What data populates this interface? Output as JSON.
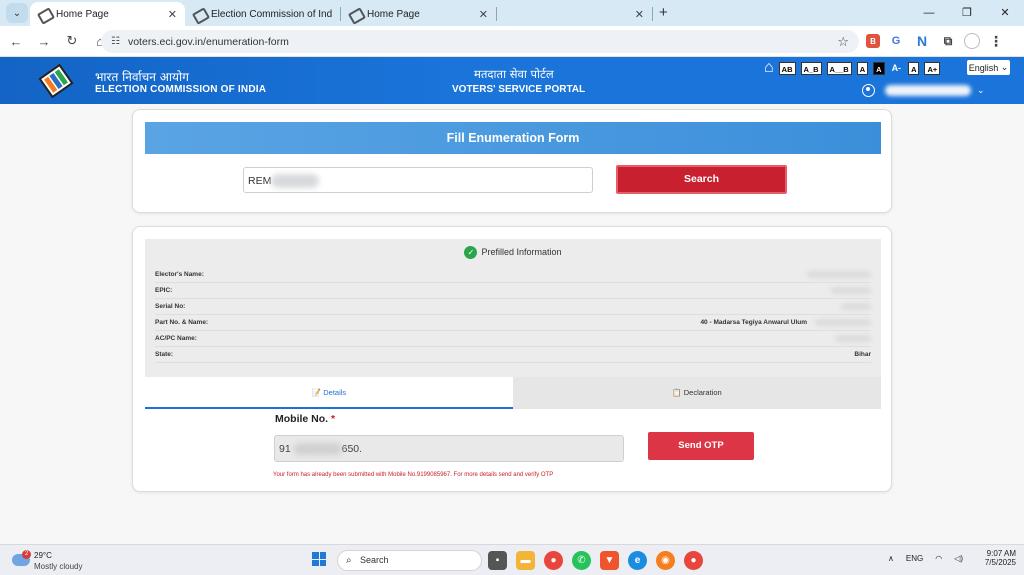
{
  "browser": {
    "tabs": [
      {
        "title": "Home Page",
        "active": true
      },
      {
        "title": "Election Commission of India",
        "active": false
      },
      {
        "title": "Home Page",
        "active": false
      },
      {
        "title": "",
        "active": false,
        "blurred": true
      }
    ],
    "url": "voters.eci.gov.in/enumeration-form"
  },
  "header": {
    "org_hindi": "भारत निर्वाचन आयोग",
    "org_english": "ELECTION COMMISSION OF INDIA",
    "portal_hindi": "मतदाता सेवा पोर्टल",
    "portal_english": "VOTERS' SERVICE PORTAL",
    "accessibility": [
      "AB",
      "A_B",
      "A__B",
      "A",
      "A",
      "A-",
      "A",
      "A+"
    ],
    "language": "English",
    "colors": {
      "header_blue": "#1a74da"
    }
  },
  "search_card": {
    "title": "Fill Enumeration Form",
    "input_value": "REM",
    "search_label": "Search"
  },
  "prefilled": {
    "title": "Prefilled Information",
    "rows": [
      {
        "label": "Elector's Name:",
        "value": ""
      },
      {
        "label": "EPIC:",
        "value": ""
      },
      {
        "label": "Serial No:",
        "value": ""
      },
      {
        "label": "Part No. & Name:",
        "value": "40 - Madarsa Tegiya Anwarul Ulum"
      },
      {
        "label": "AC/PC Name:",
        "value": ""
      },
      {
        "label": "State:",
        "value": "Bihar"
      }
    ]
  },
  "form_tabs": [
    {
      "label": "Details",
      "icon": "📝",
      "active": true
    },
    {
      "label": "Declaration",
      "icon": "📋",
      "active": false
    }
  ],
  "mobile": {
    "label": "Mobile No.",
    "required_mark": "*",
    "value": "91",
    "value_suffix": "650.",
    "send_otp_label": "Send OTP",
    "message": "Your form has already been submitted with Mobile No.9199085967. For more details send and verify OTP"
  },
  "taskbar": {
    "weather_badge": "2",
    "temperature": "29°C",
    "condition": "Mostly cloudy",
    "search_label": "Search",
    "language": "ENG",
    "time": "9:07 AM",
    "date": "7/5/2025"
  }
}
